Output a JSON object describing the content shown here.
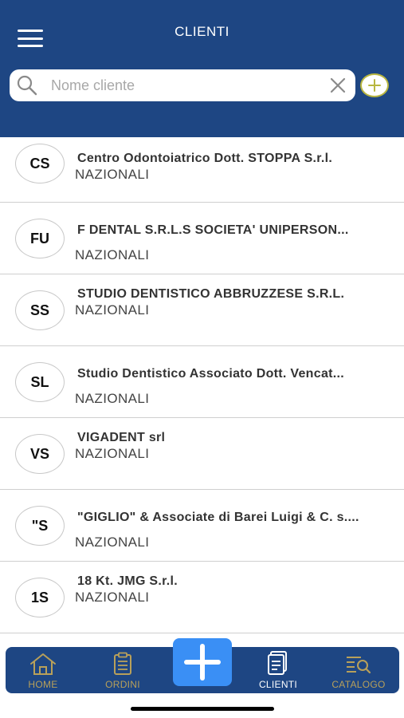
{
  "header": {
    "title": "CLIENTI",
    "menu_icon": "hamburger-menu-icon",
    "background": "#1e4683"
  },
  "search": {
    "placeholder": "Nome cliente",
    "value": "",
    "icon": "search-icon",
    "clear_icon": "close-icon"
  },
  "add_button": {
    "icon": "plus-circle-icon",
    "accent": "#b8b640"
  },
  "clients": [
    {
      "initials": "CS",
      "name": "Centro Odontoiatrico Dott. STOPPA S.r.l.",
      "category": "NAZIONALI"
    },
    {
      "initials": "FU",
      "name": "F DENTAL S.R.L.S SOCIETA' UNIPERSON...",
      "category": "NAZIONALI"
    },
    {
      "initials": "SS",
      "name": "STUDIO DENTISTICO ABBRUZZESE S.R.L.",
      "category": "NAZIONALI"
    },
    {
      "initials": "SL",
      "name": "Studio Dentistico Associato Dott. Vencat...",
      "category": "NAZIONALI"
    },
    {
      "initials": "VS",
      "name": "VIGADENT srl",
      "category": "NAZIONALI"
    },
    {
      "initials": "\"S",
      "name": "\"GIGLIO\" & Associate di Barei Luigi & C. s....",
      "category": "NAZIONALI"
    },
    {
      "initials": "1S",
      "name": "18 Kt. JMG S.r.l.",
      "category": "NAZIONALI"
    }
  ],
  "nav": {
    "home": "HOME",
    "orders": "ORDINI",
    "clients": "CLIENTI",
    "catalog": "CATALOGO",
    "active": "CLIENTI",
    "fab_icon": "plus-icon",
    "inactive_color": "#b8a05a",
    "active_color": "#ffffff",
    "fab_color": "#3a8ff5"
  }
}
